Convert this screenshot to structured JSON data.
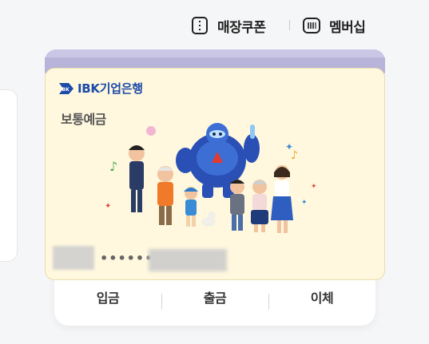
{
  "top_actions": {
    "coupon_label": "매장쿠폰",
    "coupon_icon": "coupon-icon",
    "membership_label": "멤버십",
    "membership_icon": "barcode-card-icon"
  },
  "card": {
    "bank_name": "IBK기업은행",
    "bank_mark": "IBK",
    "account_type": "보통예금",
    "masked_number": "••••••",
    "background_color": "#fff8de"
  },
  "actions": {
    "deposit": "입금",
    "withdraw": "출금",
    "transfer": "이체"
  }
}
